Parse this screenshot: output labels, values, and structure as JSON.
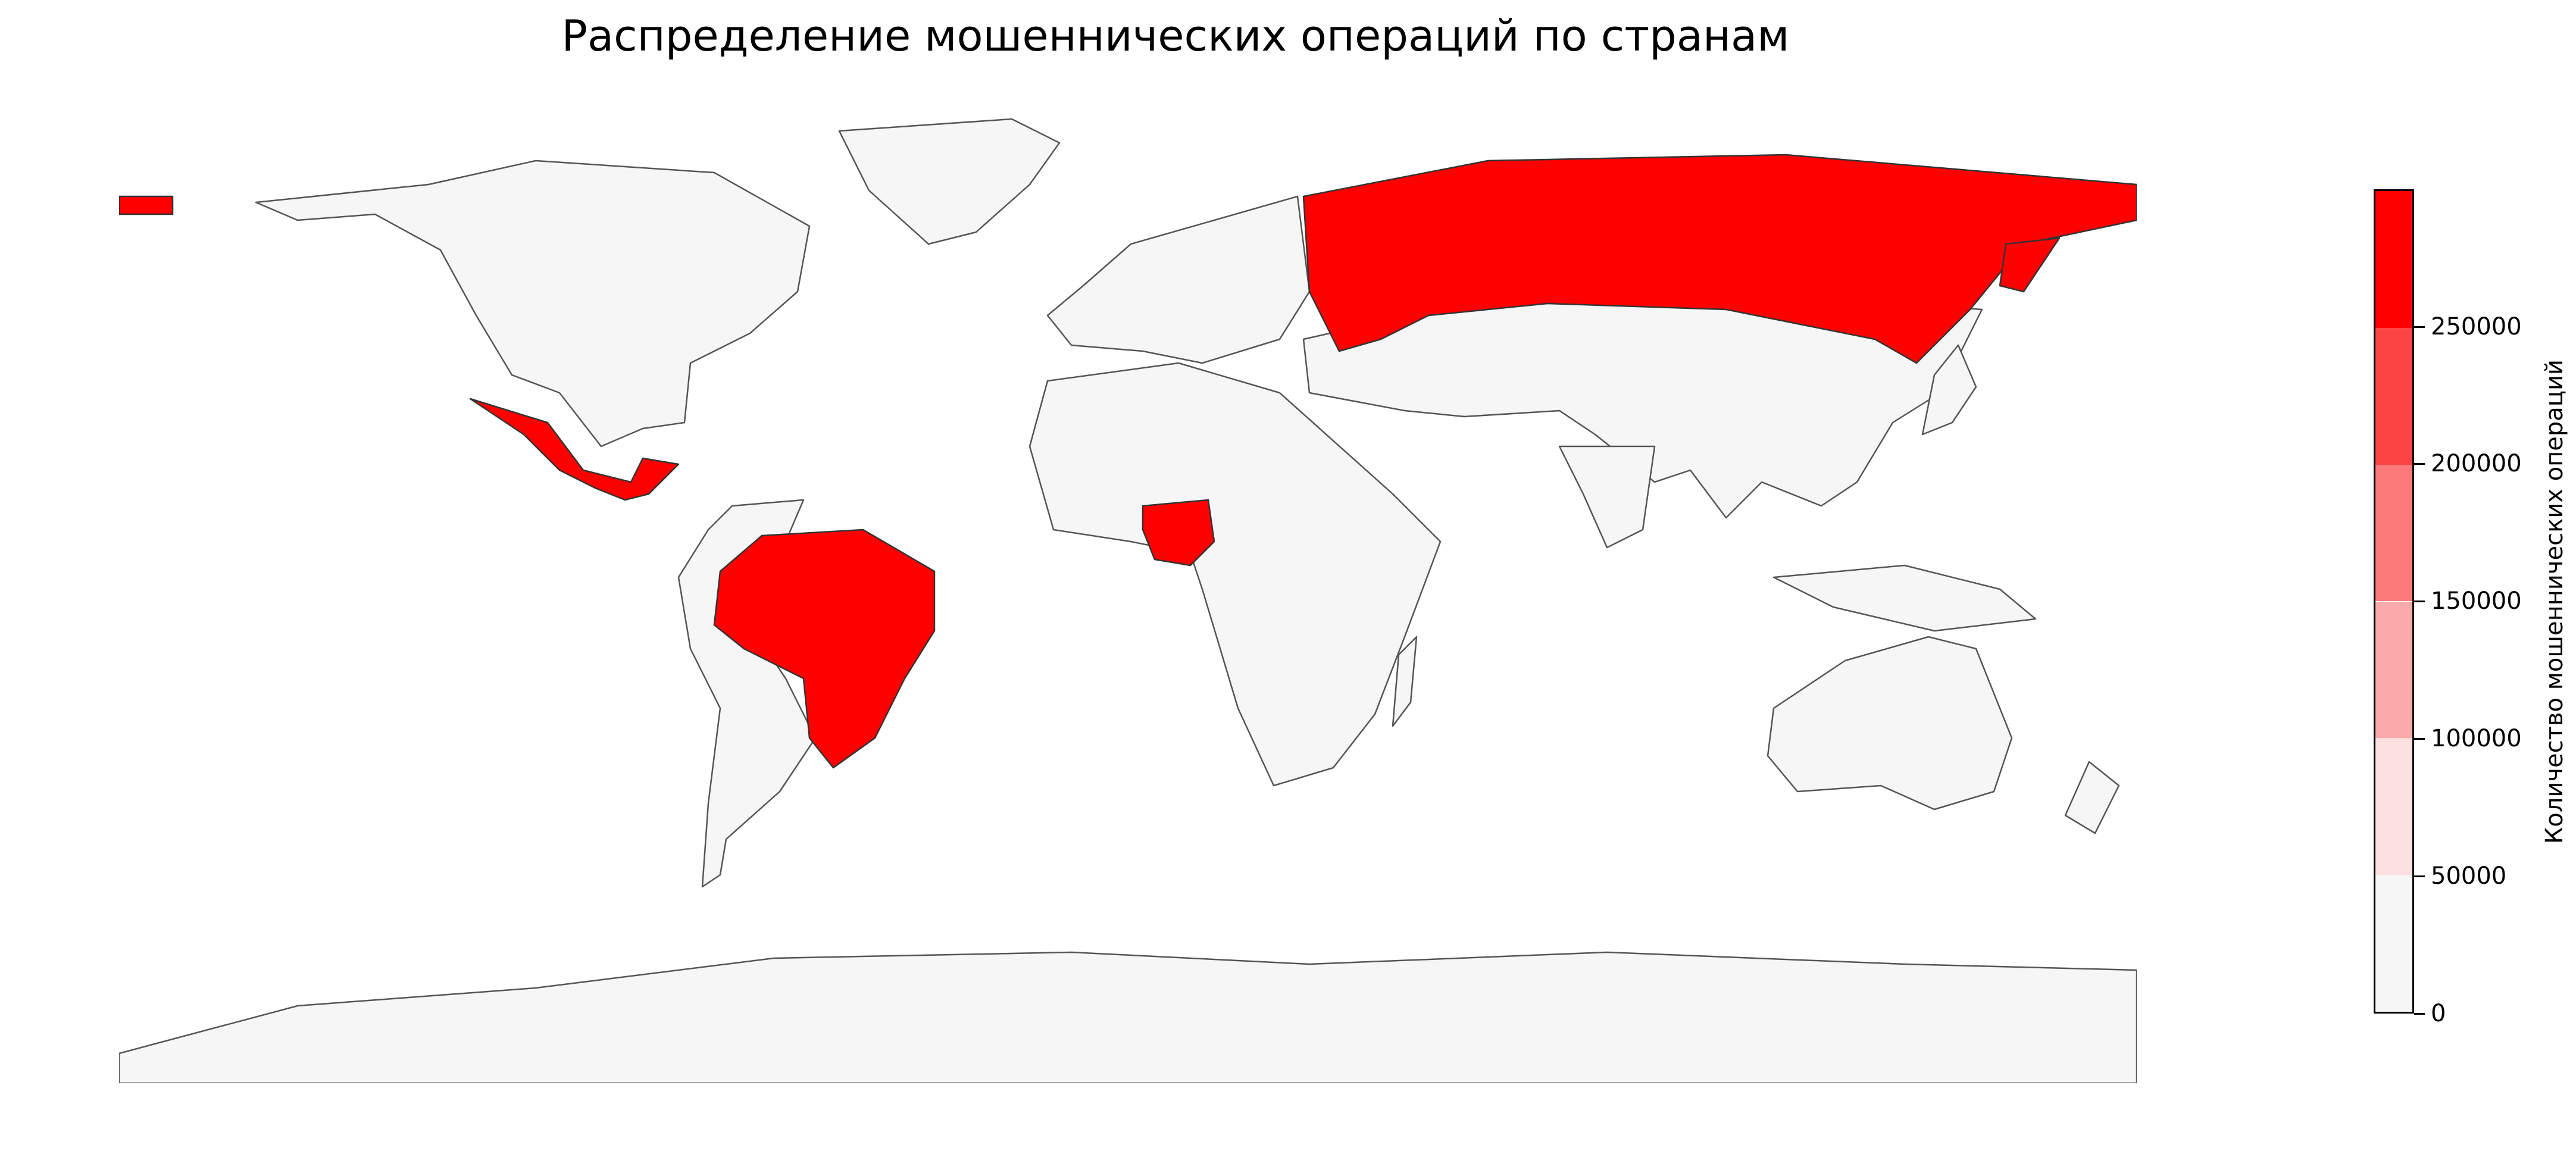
{
  "title": "Распределение мошеннических операций по странам",
  "colors": {
    "background": "#ffffff",
    "no_data_fill": "#f6f6f6",
    "border": "#555555",
    "highlight": "#ff0000"
  },
  "colorbar": {
    "label": "Количество мошеннических операций",
    "ticks": [
      "0",
      "50000",
      "100000",
      "150000",
      "200000",
      "250000"
    ],
    "bins": [
      {
        "min": 0,
        "max": 50000,
        "color": "#f6f6f6"
      },
      {
        "min": 50000,
        "max": 100000,
        "color": "#fde0e0"
      },
      {
        "min": 100000,
        "max": 150000,
        "color": "#fca9a9"
      },
      {
        "min": 150000,
        "max": 200000,
        "color": "#fd7a7a"
      },
      {
        "min": 200000,
        "max": 250000,
        "color": "#fd4444"
      },
      {
        "min": 250000,
        "max": 300000,
        "color": "#ff0000"
      }
    ],
    "range": [
      0,
      300000
    ]
  },
  "highlighted_countries": [
    {
      "name": "Russia",
      "bin": "250000+"
    },
    {
      "name": "Mexico",
      "bin": "250000+"
    },
    {
      "name": "Brazil",
      "bin": "250000+"
    },
    {
      "name": "Nigeria",
      "bin": "250000+"
    }
  ]
}
